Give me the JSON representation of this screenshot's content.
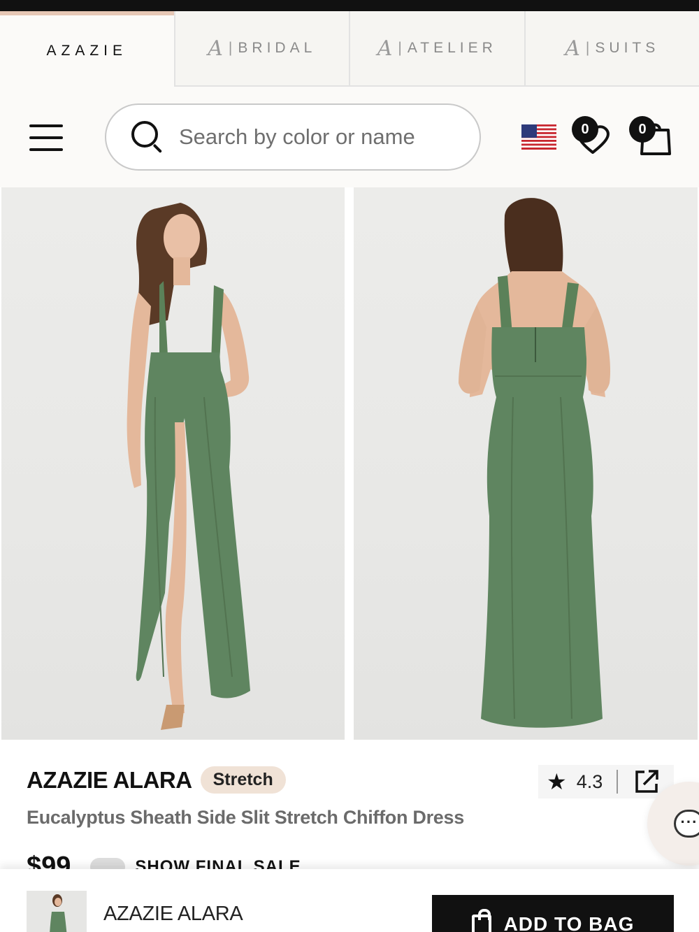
{
  "brand_tabs": [
    {
      "label": "AZAZIE",
      "active": true
    },
    {
      "monogram": "A",
      "label": "BRIDAL",
      "active": false
    },
    {
      "monogram": "A",
      "label": "ATELIER",
      "active": false
    },
    {
      "monogram": "A",
      "label": "SUITS",
      "active": false
    }
  ],
  "header": {
    "menu_icon": "hamburger-menu-icon",
    "search": {
      "placeholder": "Search by color or name",
      "value": ""
    },
    "flag_icon": "us-flag-icon",
    "wishlist_count": "0",
    "cart_count": "0"
  },
  "gallery": {
    "images": [
      {
        "name": "front-view-photo",
        "dress_color": "#5f8560"
      },
      {
        "name": "back-view-photo",
        "dress_color": "#5f8560"
      }
    ]
  },
  "product": {
    "brand": "AZAZIE ALARA",
    "badge": "Stretch",
    "rating": "4.3",
    "title": "Eucalyptus Sheath Side Slit Stretch Chiffon Dress",
    "price": "$99",
    "final_sale_label": "SHOW FINAL SALE"
  },
  "sticky_bar": {
    "name": "AZAZIE ALARA",
    "add_to_bag_label": "ADD TO BAG"
  },
  "colors": {
    "accent_tab": "#e6c7b5",
    "badge_bg": "#f0e2d6",
    "dress_green": "#5f8560",
    "button_bg": "#111111"
  }
}
